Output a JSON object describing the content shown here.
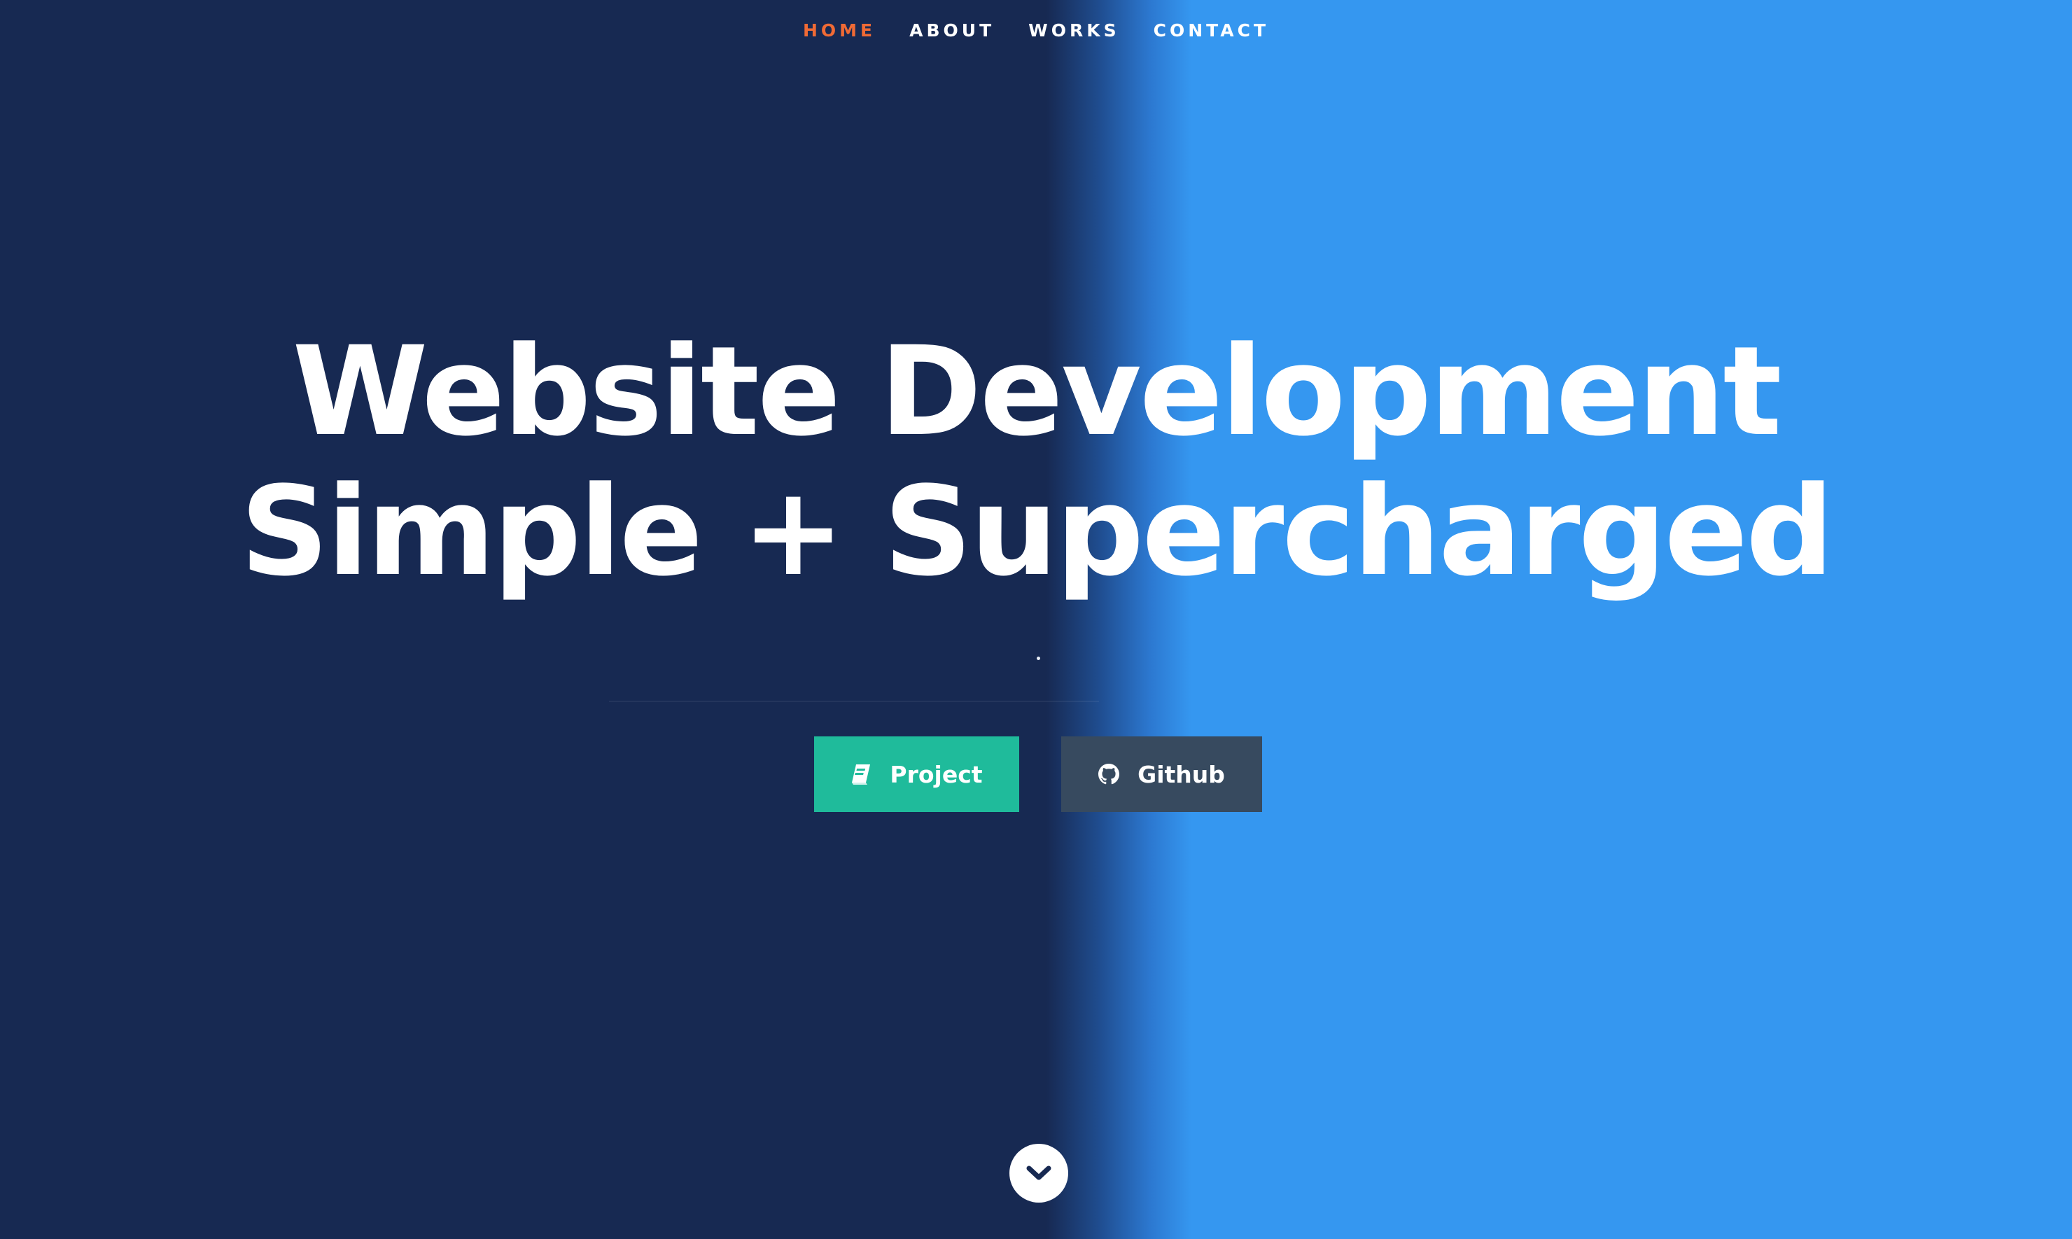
{
  "nav": {
    "items": [
      {
        "label": "HOME",
        "active": true
      },
      {
        "label": "ABOUT",
        "active": false
      },
      {
        "label": "WORKS",
        "active": false
      },
      {
        "label": "CONTACT",
        "active": false
      }
    ]
  },
  "hero": {
    "title_line1": "Website Development",
    "title_line2": "Simple + Supercharged"
  },
  "buttons": {
    "project_label": "Project",
    "project_icon": "book-icon",
    "github_label": "Github",
    "github_icon": "github-icon"
  },
  "scroll": {
    "icon": "chevron-down-icon"
  },
  "colors": {
    "navy_background": "#172952",
    "blue_background": "#3597f0",
    "nav_active": "#f06a35",
    "project_button": "#1fbb9b",
    "github_button": "#374a5f"
  }
}
